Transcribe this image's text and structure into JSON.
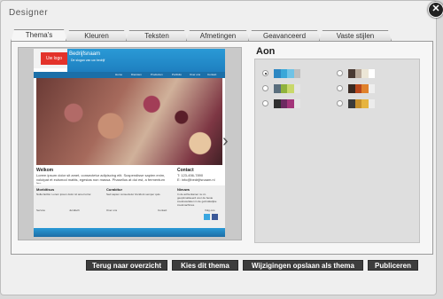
{
  "window": {
    "title": "Designer",
    "close_glyph": "✕"
  },
  "tabs": [
    "Thema's",
    "Kleuren",
    "Teksten",
    "Afmetingen",
    "Geavanceerd",
    "Vaste stijlen"
  ],
  "preview": {
    "logo": "Uw logo",
    "company": "Bedrijfsnaam",
    "slogan": "De slogan van uw bedrijf",
    "nav": [
      "Home",
      "Diensten",
      "Producten",
      "Portfolio",
      "Over ons",
      "Contact"
    ],
    "welcome_title": "Welkom",
    "welcome_text": "Lorem ipsum dolor sit amet, consectetur adipiscing elit. Suspendisse sapien enim, volutpat et euismod mattis, egestas non massa. Phasellus at dui est, a fermentum leo.",
    "welcome_text2": "Nulla facilisi. Suspendisse potenti. Praesent eget massa. Cras sit amet ex mauris.",
    "contact_title": "Contact",
    "contact_lines": [
      "T: 123-456-7890",
      "E: info@bedrijfsnaam.nl"
    ],
    "news_title": "Nieuws",
    "news_text": "In de achterkamer nu zo geoptimaliseerd voor de beste zoekresultaten in de gebruikelijke zoekmachines.",
    "morbi_title": "Morbitisus",
    "morbi_text": "Nulla facilisi. Lorem ipsum dolor sit amet tortor.",
    "curabitur_title": "Curabitur",
    "curabitur_text": "Sed sapien consectetur tincidunt semper quis.",
    "footer_cols": [
      "Service",
      "Juridisch",
      "Over ons",
      "Contact",
      "Volg ons"
    ],
    "arrow_glyph": "›"
  },
  "styles": {
    "name": "Aon",
    "options": [
      {
        "selected": true,
        "colors": [
          "#2d87c2",
          "#39a7d8",
          "#6fc3e6",
          "#bfbfbf"
        ]
      },
      {
        "selected": false,
        "colors": [
          "#4a3a33",
          "#b8a99a",
          "#ece6d6",
          "#ffffff"
        ]
      },
      {
        "selected": false,
        "colors": [
          "#5a6e7d",
          "#8fb23c",
          "#c9d86a",
          "#e5e5e5"
        ]
      },
      {
        "selected": false,
        "colors": [
          "#3a2a22",
          "#b8471c",
          "#e0812b",
          "#eeeeee"
        ]
      },
      {
        "selected": false,
        "colors": [
          "#2f2f2f",
          "#6c2a61",
          "#a3357a",
          "#e5e5e5"
        ]
      },
      {
        "selected": false,
        "colors": [
          "#3b3b3b",
          "#c7902c",
          "#e6b43f",
          "#ececec"
        ]
      }
    ]
  },
  "buttons": [
    "Terug naar overzicht",
    "Kies dit thema",
    "Wijzigingen opslaan als thema",
    "Publiceren"
  ]
}
